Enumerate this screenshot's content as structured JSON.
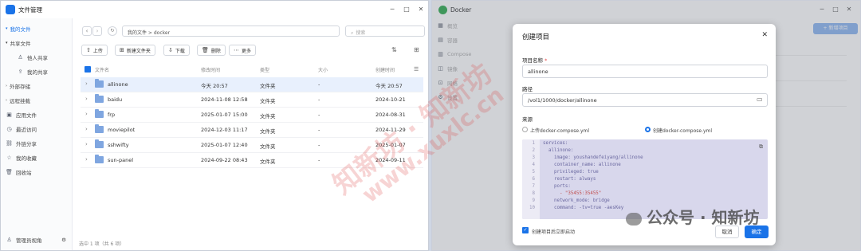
{
  "left_window": {
    "title": "文件管理",
    "sidebar": [
      {
        "label": "我的文件",
        "icon": "folder-icon",
        "active": true,
        "sub": false
      },
      {
        "label": "共享文件",
        "icon": "share-icon",
        "active": false,
        "sub": false
      },
      {
        "label": "他人共享",
        "icon": "user-icon",
        "active": false,
        "sub": true
      },
      {
        "label": "我的共享",
        "icon": "share-out-icon",
        "active": false,
        "sub": true
      },
      {
        "label": "外部存储",
        "icon": "storage-icon",
        "active": false,
        "sub": false
      },
      {
        "label": "远程挂载",
        "icon": "mount-icon",
        "active": false,
        "sub": false
      },
      {
        "label": "应用文件",
        "icon": "app-icon",
        "active": false,
        "sub": false
      },
      {
        "label": "最近访问",
        "icon": "clock-icon",
        "active": false,
        "sub": false
      },
      {
        "label": "外链分享",
        "icon": "link-icon",
        "active": false,
        "sub": false
      },
      {
        "label": "我的收藏",
        "icon": "star-icon",
        "active": false,
        "sub": false
      },
      {
        "label": "回收站",
        "icon": "trash-icon",
        "active": false,
        "sub": false
      }
    ],
    "admin_view": "管理员视角",
    "breadcrumb": "我的文件 > docker",
    "search_placeholder": "搜索",
    "toolbar": {
      "upload": "上传",
      "new_folder": "新建文件夹",
      "download": "下载",
      "delete": "删除",
      "more": "更多"
    },
    "columns": {
      "name": "文件名",
      "modified": "修改时间",
      "type": "类型",
      "size": "大小",
      "created": "创建时间"
    },
    "rows": [
      {
        "name": "allinone",
        "modified": "今天 20:57",
        "type": "文件夹",
        "size": "-",
        "created": "今天 20:57",
        "selected": true
      },
      {
        "name": "baidu",
        "modified": "2024-11-08 12:58",
        "type": "文件夹",
        "size": "-",
        "created": "2024-10-21",
        "selected": false
      },
      {
        "name": "frp",
        "modified": "2025-01-07 15:00",
        "type": "文件夹",
        "size": "-",
        "created": "2024-08-31",
        "selected": false
      },
      {
        "name": "moviepilot",
        "modified": "2024-12-03 11:17",
        "type": "文件夹",
        "size": "-",
        "created": "2024-11-29",
        "selected": false
      },
      {
        "name": "sshwifty",
        "modified": "2025-01-07 12:40",
        "type": "文件夹",
        "size": "-",
        "created": "2025-01-07",
        "selected": false
      },
      {
        "name": "sun-panel",
        "modified": "2024-09-22 08:43",
        "type": "文件夹",
        "size": "-",
        "created": "2024-09-11",
        "selected": false
      }
    ],
    "status": "选中 1 项（共 6 项）"
  },
  "right_window": {
    "title": "Docker",
    "sidebar": [
      "概览",
      "容器",
      "Compose",
      "镜像",
      "网络",
      "设置"
    ],
    "add_button": "+ 新增项目",
    "dialog": {
      "title": "创建项目",
      "name_label": "项目名称",
      "name_value": "allinone",
      "path_label": "路径",
      "path_value": "/vol1/1000/docker/allinone",
      "source_label": "来源",
      "radio_upload": "上传docker-compose.yml",
      "radio_create": "创建docker-compose.yml",
      "code": [
        "services:",
        "  allinone:",
        "    image: youshandefeiyang/allinone",
        "    container_name: allinone",
        "    privileged: true",
        "    restart: always",
        "    ports:",
        "      - \"35455:35455\"",
        "    network_mode: bridge",
        "    command: -tv=true -aesKey"
      ],
      "checkbox_label": "创建项目后立即启动",
      "cancel": "取消",
      "confirm": "确定"
    }
  },
  "watermarks": [
    "知新坊 · 知新坊",
    "www.xuxlc.cn"
  ],
  "footer_watermark": "公众号 · 知新坊",
  "colors": {
    "accent": "#1a73e8",
    "selected_row": "#e8f0fd",
    "code_bg": "#d8d7ec",
    "watermark": "#dc3c3c"
  }
}
